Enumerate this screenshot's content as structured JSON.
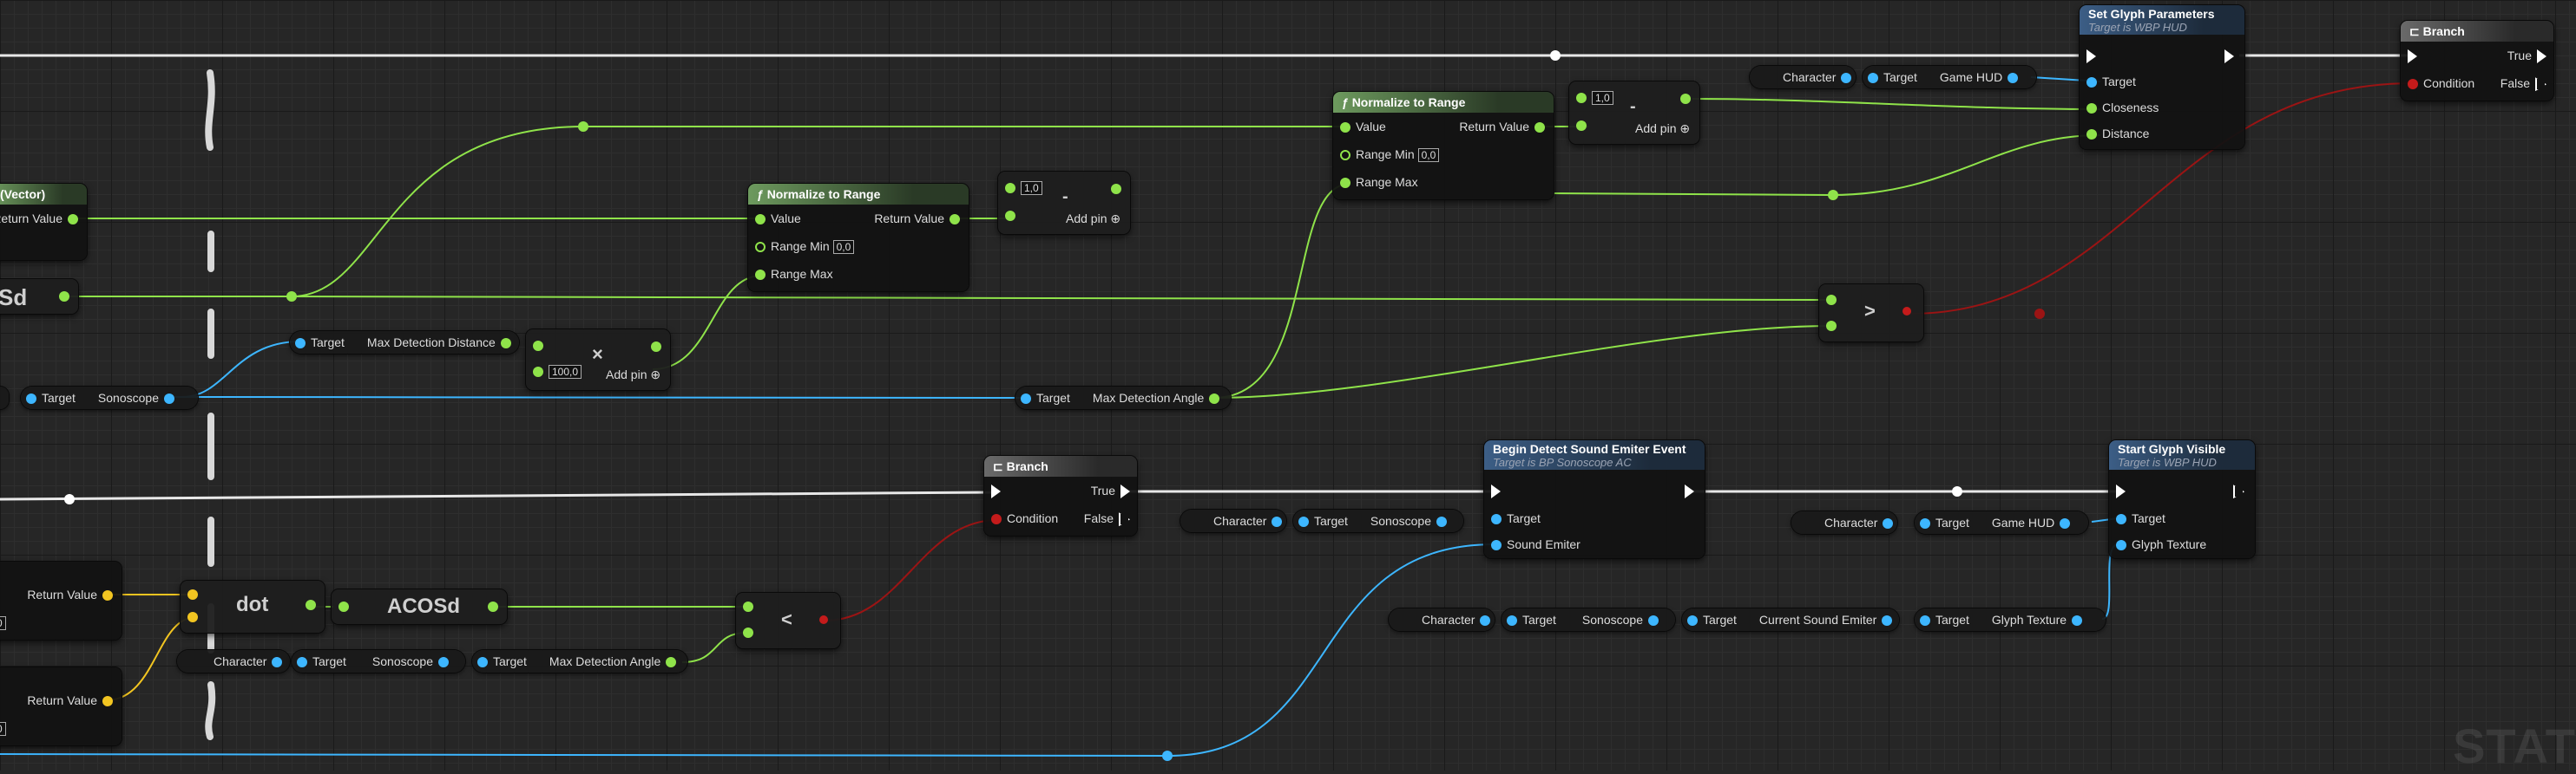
{
  "graph": {
    "nodes": {
      "set_glyph_params": {
        "title": "Set Glyph Parameters",
        "subtitle": "Target is WBP HUD",
        "pin_target": "Target",
        "pin_closeness": "Closeness",
        "pin_distance": "Distance"
      },
      "branch_top": {
        "title": "Branch",
        "pin_condition": "Condition",
        "pin_true": "True",
        "pin_false": "False"
      },
      "normalize_1": {
        "title": "Normalize to Range",
        "pin_value": "Value",
        "pin_return": "Return Value",
        "pin_range_min": "Range Min",
        "range_min_value": "0,0",
        "pin_range_max": "Range Max"
      },
      "normalize_2": {
        "title": "Normalize to Range",
        "pin_value": "Value",
        "pin_return": "Return Value",
        "pin_range_min": "Range Min",
        "range_min_value": "0,0",
        "pin_range_max": "Range Max"
      },
      "vector_partial": {
        "title": "(Vector)",
        "pin_return": "Return Value"
      },
      "sd_partial": {
        "label": "Sd"
      },
      "subtract_1": {
        "symbol": "-",
        "value": "1,0",
        "add_pin": "Add pin"
      },
      "subtract_2": {
        "symbol": "-",
        "value": "1,0",
        "add_pin": "Add pin"
      },
      "multiply": {
        "symbol": "×",
        "value": "100,0",
        "add_pin": "Add pin"
      },
      "greater": {
        "symbol": ">"
      },
      "less": {
        "symbol": "<"
      },
      "dot": {
        "label": "dot"
      },
      "acosd": {
        "label": "ACOSd"
      },
      "branch_mid": {
        "title": "Branch",
        "pin_condition": "Condition",
        "pin_true": "True",
        "pin_false": "False"
      },
      "begin_detect": {
        "title": "Begin Detect Sound Emiter Event",
        "subtitle": "Target is BP Sonoscope AC",
        "pin_target": "Target",
        "pin_sound_emiter": "Sound Emiter"
      },
      "start_glyph": {
        "title": "Start Glyph Visible",
        "subtitle": "Target is WBP HUD",
        "pin_target": "Target",
        "pin_glyph_texture": "Glyph Texture"
      },
      "ret_1": {
        "label": "Return Value",
        "value": "0"
      },
      "ret_2": {
        "label": "Return Value",
        "value": "0"
      }
    },
    "vars": {
      "character": "Character",
      "target": "Target",
      "game_hud": "Game HUD",
      "sonoscope": "Sonoscope",
      "max_detection_distance": "Max Detection Distance",
      "max_detection_angle": "Max Detection Angle",
      "current_sound_emiter": "Current Sound Emiter",
      "glyph_texture": "Glyph Texture"
    },
    "watermark": "STAT"
  },
  "colors": {
    "exec": "#ffffff",
    "float": "#8fe34a",
    "object": "#3db6ff",
    "bool": "#c41b1b",
    "vector": "#f2c521"
  }
}
